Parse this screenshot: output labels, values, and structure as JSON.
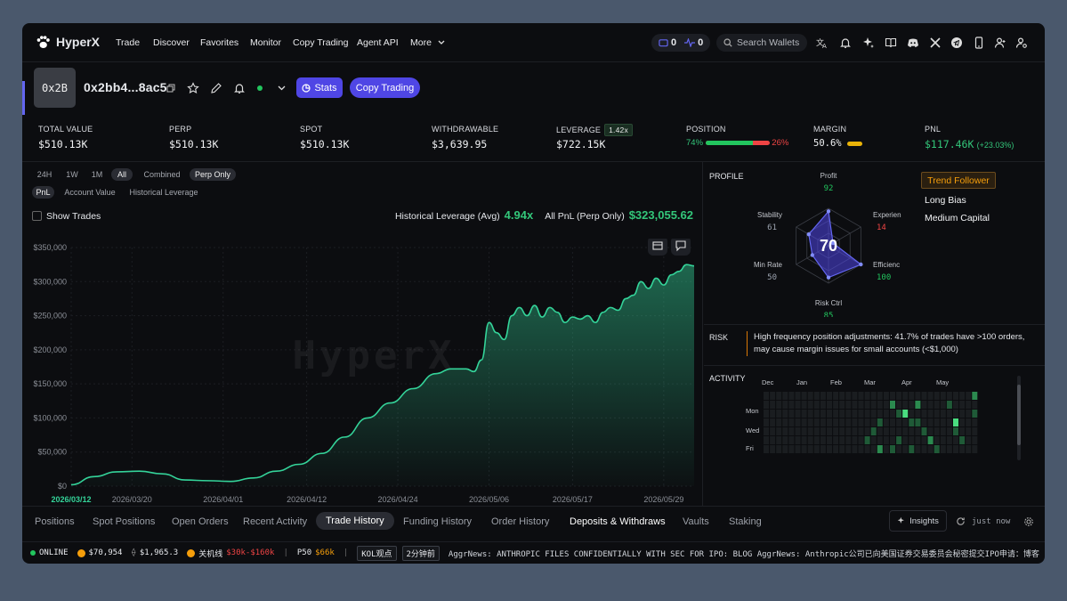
{
  "nav": {
    "brand": "HyperX",
    "links": [
      "Trade",
      "Discover",
      "Favorites",
      "Monitor",
      "Copy Trading",
      "Agent API",
      "More"
    ],
    "wallet_count": "0",
    "activity_count": "0",
    "search_placeholder": "Search Wallets"
  },
  "profile": {
    "avatar_text": "0x2B",
    "address": "0x2bb4...8ac5",
    "stats_button": "Stats",
    "copy_button": "Copy Trading",
    "status_color": "#22c55e"
  },
  "stats": {
    "total_value": {
      "label": "TOTAL VALUE",
      "value": "$510.13K"
    },
    "perp": {
      "label": "PERP",
      "value": "$510.13K"
    },
    "spot": {
      "label": "SPOT",
      "value": "$510.13K"
    },
    "withdrawable": {
      "label": "WITHDRAWABLE",
      "value": "$3,639.95"
    },
    "leverage": {
      "label": "LEVERAGE",
      "badge": "1.42x",
      "value": "$722.15K"
    },
    "position": {
      "label": "POSITION",
      "long": "74%",
      "short": "26%",
      "long_fraction": 0.74
    },
    "margin": {
      "label": "MARGIN",
      "value": "50.6%",
      "fraction": 0.506
    },
    "pnl": {
      "label": "PNL",
      "value": "$117.46K",
      "change": "(+23.03%)"
    }
  },
  "chart_controls": {
    "ranges": [
      "24H",
      "1W",
      "1M",
      "All"
    ],
    "active_range": "All",
    "modes": [
      "Combined",
      "Perp Only"
    ],
    "active_mode": "Perp Only",
    "metrics": [
      "PnL",
      "Account Value",
      "Historical Leverage"
    ],
    "active_metric": "PnL",
    "show_trades": "Show Trades",
    "hist_lev_label": "Historical Leverage (Avg)",
    "hist_lev_value": "4.94x",
    "all_pnl_label": "All PnL (Perp Only)",
    "all_pnl_value": "$323,055.62",
    "watermark": "HyperX"
  },
  "chart_data": {
    "type": "area",
    "title": "",
    "xlabel": "",
    "ylabel": "",
    "ylim": [
      0,
      350000
    ],
    "yticks": [
      "$0",
      "$50,000",
      "$100,000",
      "$150,000",
      "$200,000",
      "$250,000",
      "$300,000",
      "$350,000"
    ],
    "xticks": [
      "2026/03/12",
      "2026/03/20",
      "2026/04/01",
      "2026/04/12",
      "2026/04/24",
      "2026/05/06",
      "2026/05/17",
      "2026/05/29"
    ],
    "xlim": [
      "2026/03/12",
      "2026/06/02"
    ],
    "color": "#34d399",
    "grid": true,
    "x": [
      "2026/03/12",
      "2026/03/15",
      "2026/03/18",
      "2026/03/21",
      "2026/03/24",
      "2026/03/27",
      "2026/03/30",
      "2026/04/02",
      "2026/04/05",
      "2026/04/08",
      "2026/04/11",
      "2026/04/14",
      "2026/04/17",
      "2026/04/20",
      "2026/04/23",
      "2026/04/26",
      "2026/04/29",
      "2026/05/01",
      "2026/05/03",
      "2026/05/04",
      "2026/05/05",
      "2026/05/06",
      "2026/05/07",
      "2026/05/08",
      "2026/05/09",
      "2026/05/10",
      "2026/05/11",
      "2026/05/12",
      "2026/05/13",
      "2026/05/14",
      "2026/05/15",
      "2026/05/16",
      "2026/05/17",
      "2026/05/18",
      "2026/05/19",
      "2026/05/20",
      "2026/05/21",
      "2026/05/22",
      "2026/05/23",
      "2026/05/24",
      "2026/05/25",
      "2026/05/26",
      "2026/05/27",
      "2026/05/28",
      "2026/05/29",
      "2026/05/30",
      "2026/05/31",
      "2026/06/01",
      "2026/06/02"
    ],
    "y": [
      2000,
      14000,
      21000,
      22000,
      18000,
      9000,
      8000,
      7000,
      12000,
      22000,
      32000,
      48000,
      72000,
      100000,
      122000,
      143000,
      165000,
      172000,
      172000,
      168000,
      185000,
      240000,
      225000,
      215000,
      250000,
      262000,
      250000,
      265000,
      248000,
      262000,
      255000,
      240000,
      248000,
      245000,
      250000,
      240000,
      255000,
      262000,
      258000,
      275000,
      280000,
      300000,
      290000,
      305000,
      295000,
      310000,
      315000,
      325000,
      323000
    ]
  },
  "profile_panel": {
    "title": "PROFILE",
    "score": "70",
    "axes": [
      {
        "name": "Profit",
        "value": "92",
        "color": "#22c55e"
      },
      {
        "name": "Experien",
        "value": "14",
        "color": "#ef4444"
      },
      {
        "name": "Efficienc",
        "value": "100",
        "color": "#22c55e"
      },
      {
        "name": "Risk Ctrl",
        "value": "85",
        "color": "#22c55e"
      },
      {
        "name": "Min Rate",
        "value": "50",
        "color": "#9ca3af"
      },
      {
        "name": "Stability",
        "value": "61",
        "color": "#9ca3af"
      }
    ],
    "tags": [
      "Trend Follower",
      "Long Bias",
      "Medium Capital"
    ]
  },
  "risk": {
    "title": "RISK",
    "text": "High frequency position adjustments: 41.7% of trades have >100 orders, may cause margin issues for small accounts (<$1,000)"
  },
  "activity": {
    "title": "ACTIVITY",
    "months": [
      "Dec",
      "Jan",
      "Feb",
      "Mar",
      "Apr",
      "May"
    ],
    "days": [
      "Mon",
      "Wed",
      "Fri"
    ]
  },
  "bottom_tabs": {
    "items": [
      "Positions",
      "Spot Positions",
      "Open Orders",
      "Recent Activity",
      "Trade History",
      "Funding History",
      "Order History",
      "Deposits & Withdraws",
      "Vaults",
      "Staking"
    ],
    "active": "Trade History",
    "insights": "Insights",
    "refresh": "just now"
  },
  "ticker": {
    "status": "ONLINE",
    "btc": "$70,954",
    "eth": "$1,965.3",
    "label_cn": "关机线",
    "range": "$30k-$160k",
    "p50_label": "P50",
    "p50_value": "$66k",
    "kol": "KOL观点",
    "time": "2分钟前",
    "news": "AggrNews: ANTHROPIC FILES CONFIDENTIALLY WITH SEC FOR IPO: BLOG AggrNews: Anthropic公司已向美国证券交易委员会秘密提交IPO申请：博客"
  }
}
